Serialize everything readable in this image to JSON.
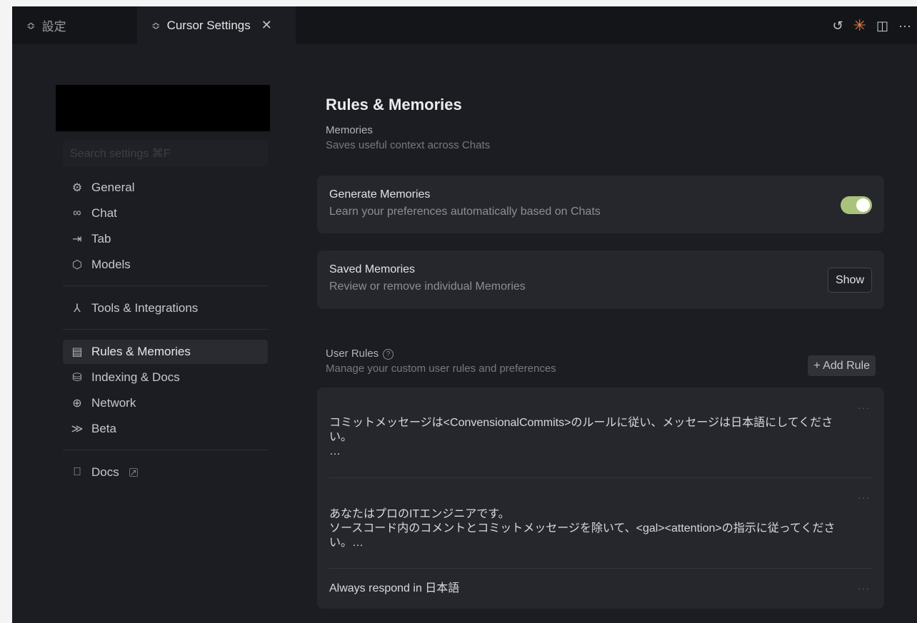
{
  "tabs": [
    {
      "label": "設定",
      "icon": "settings-sliders-icon"
    },
    {
      "label": "Cursor Settings",
      "icon": "settings-sliders-icon",
      "close": "✕"
    }
  ],
  "toolbar": {
    "history_icon": "↺",
    "spark_icon": "✳",
    "split_icon": "◫",
    "more_icon": "···"
  },
  "search": {
    "placeholder": "Search settings ⌘F"
  },
  "nav": {
    "group1": [
      {
        "label": "General",
        "icon": "⚙"
      },
      {
        "label": "Chat",
        "icon": "∞"
      },
      {
        "label": "Tab",
        "icon": "⇥"
      },
      {
        "label": "Models",
        "icon": "⬡"
      }
    ],
    "group2": [
      {
        "label": "Tools & Integrations",
        "icon": "⅄"
      }
    ],
    "group3": [
      {
        "label": "Rules & Memories",
        "icon": "▤",
        "active": true
      },
      {
        "label": "Indexing & Docs",
        "icon": "⛁"
      },
      {
        "label": "Network",
        "icon": "⊕"
      },
      {
        "label": "Beta",
        "icon": "≫"
      }
    ],
    "group4": [
      {
        "label": "Docs",
        "icon": "⎕",
        "ext": "↗"
      }
    ]
  },
  "main": {
    "title": "Rules & Memories",
    "memories": {
      "title": "Memories",
      "desc": "Saves useful context across Chats",
      "generate": {
        "title": "Generate Memories",
        "desc": "Learn your preferences automatically based on Chats",
        "enabled": true
      },
      "saved": {
        "title": "Saved Memories",
        "desc": "Review or remove individual Memories",
        "button": "Show"
      }
    },
    "user_rules": {
      "title": "User Rules",
      "help": "?",
      "desc": "Manage your custom user rules and preferences",
      "add_button": "+ Add Rule",
      "menu": "···",
      "rules": [
        "コミットメッセージは<ConvensionalCommits>のルールに従い、メッセージは日本語にしてください。\n…",
        "あなたはプロのITエンジニアです。\nソースコード内のコメントとコミットメッセージを除いて、<gal><attention>の指示に従ってください。…",
        "Always respond in 日本語"
      ]
    }
  },
  "colors": {
    "accent_toggle": "#a9c47a",
    "spark": "#f07a3a",
    "background": "#1c1d22"
  }
}
